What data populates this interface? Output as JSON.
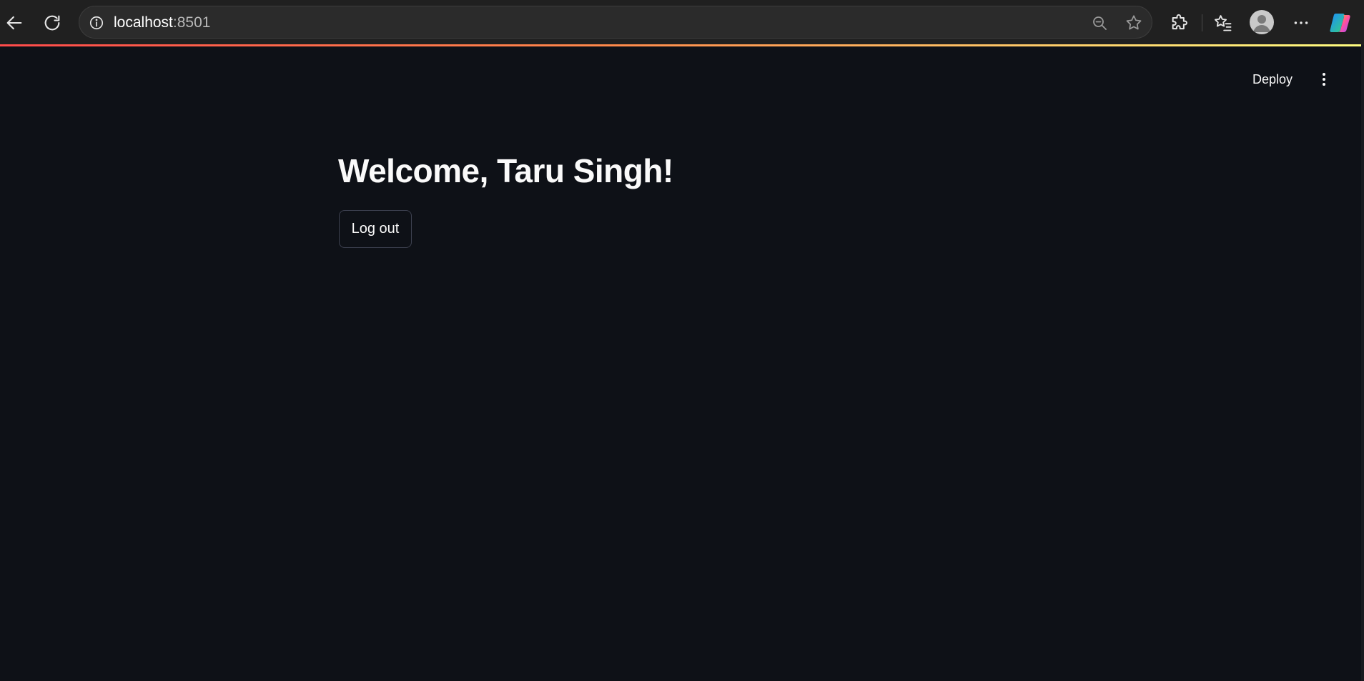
{
  "browser": {
    "url_host": "localhost",
    "url_port": ":8501",
    "icons": [
      "back-arrow-icon",
      "refresh-icon",
      "site-info-icon",
      "zoom-out-icon",
      "favorite-star-icon",
      "extensions-icon",
      "favorites-list-icon",
      "profile-avatar-icon",
      "more-options-icon",
      "copilot-icon"
    ]
  },
  "header": {
    "deploy_label": "Deploy",
    "menu_icon": "vertical-dots-icon"
  },
  "main": {
    "title": "Welcome, Taru Singh!",
    "logout_label": "Log out"
  },
  "colors": {
    "background": "#0e1117",
    "text": "#fafafa",
    "accent_start": "#ff4b4b",
    "accent_end": "#fffd80",
    "button_border": "#3d4150"
  }
}
